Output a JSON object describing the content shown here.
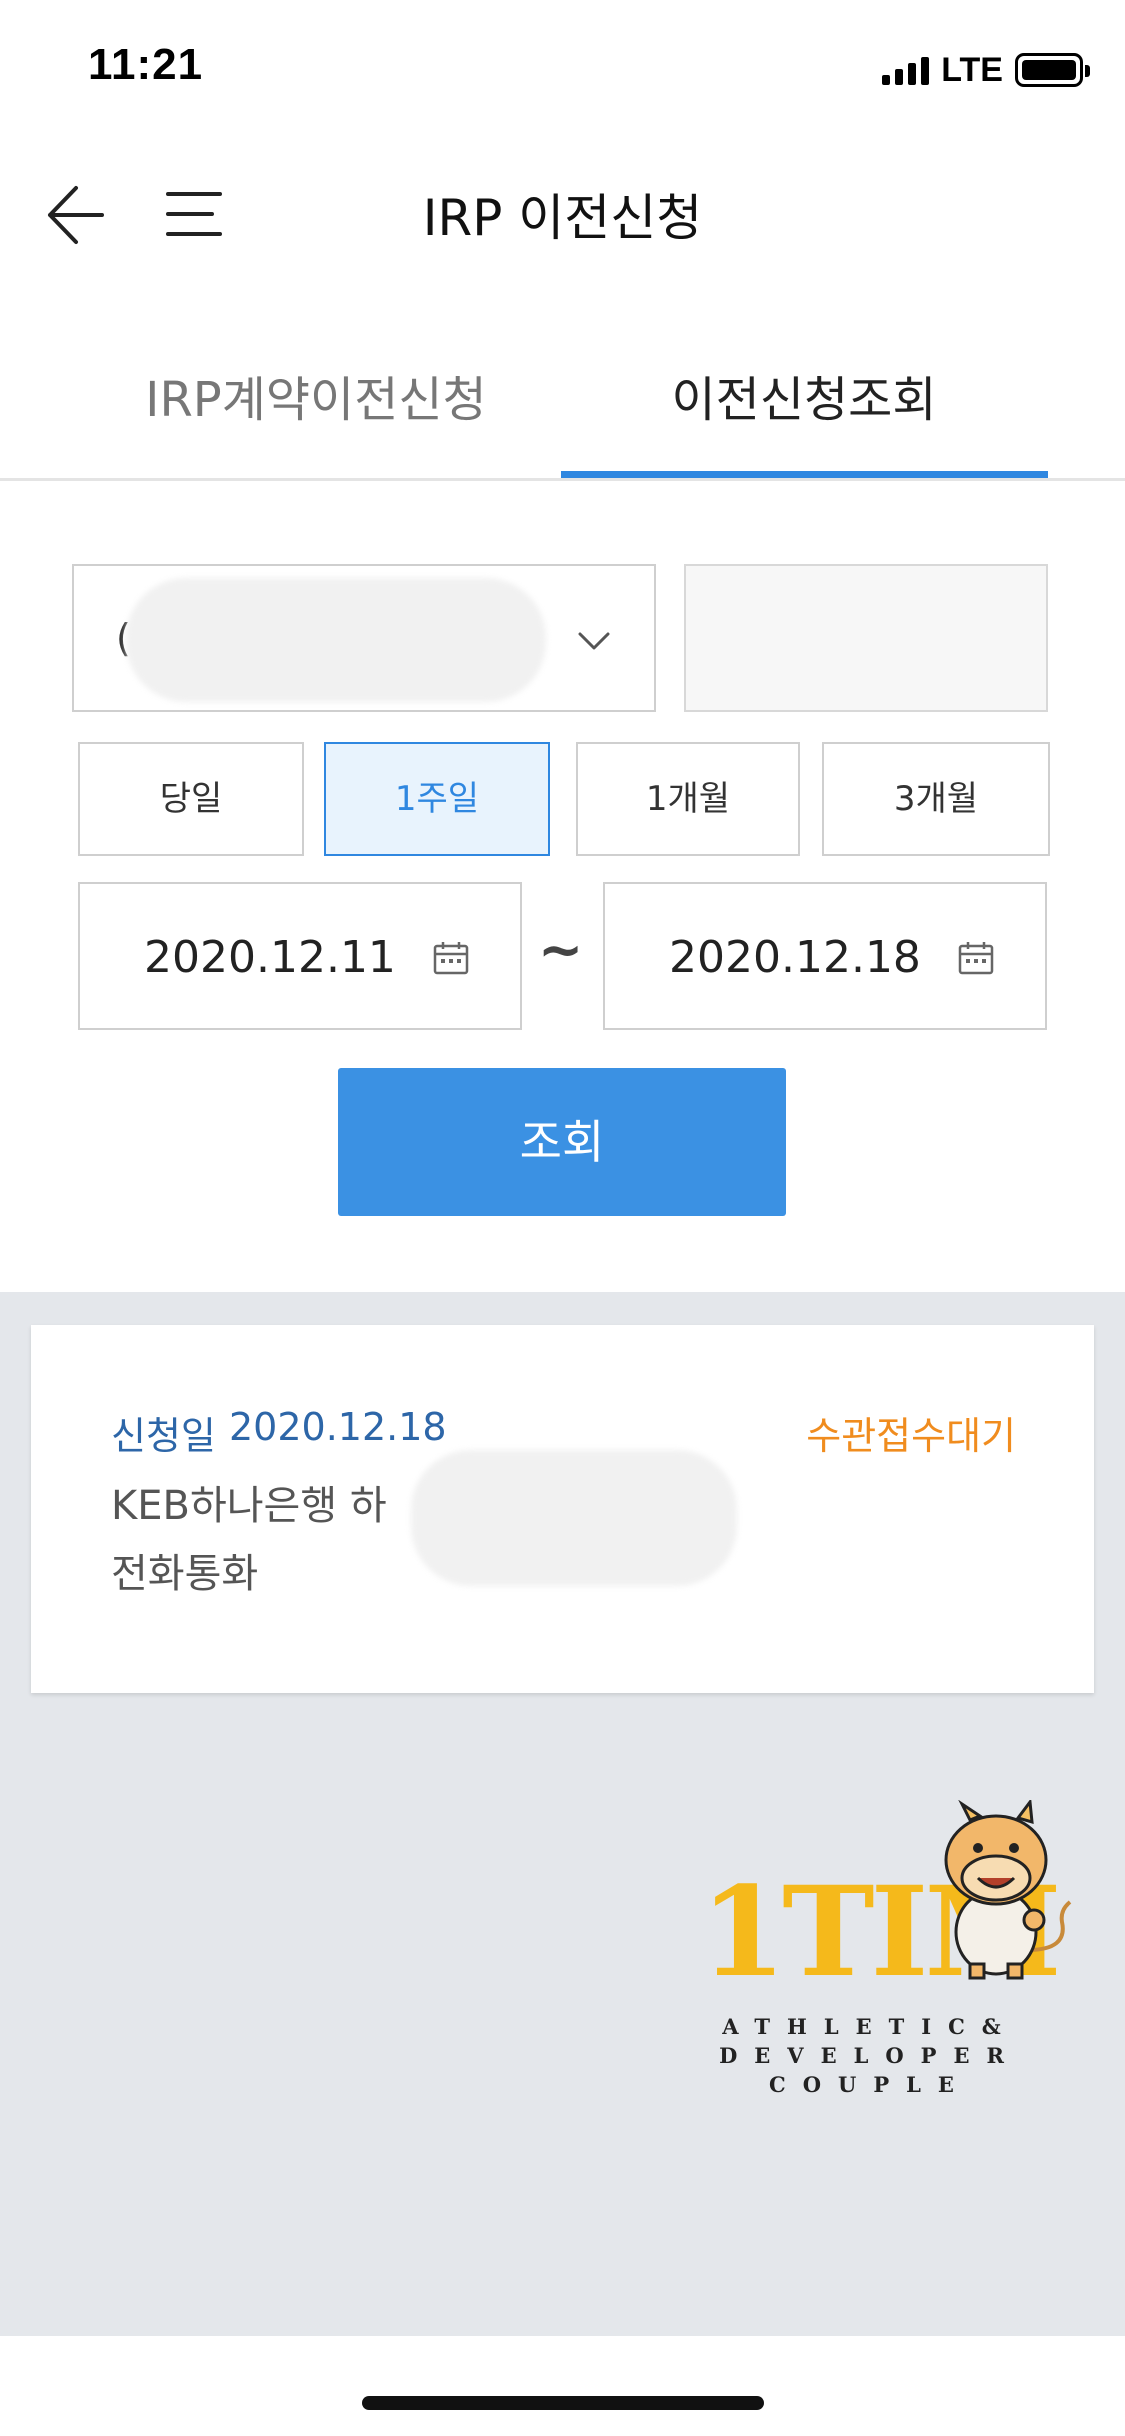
{
  "status_bar": {
    "time": "11:21",
    "network": "LTE"
  },
  "header": {
    "title": "IRP 이전신청"
  },
  "tabs": [
    {
      "label": "IRP계약이전신청",
      "active": false
    },
    {
      "label": "이전신청조회",
      "active": true
    }
  ],
  "filter": {
    "account_prefix": "(",
    "periods": [
      {
        "label": "당일",
        "active": false
      },
      {
        "label": "1주일",
        "active": true
      },
      {
        "label": "1개월",
        "active": false
      },
      {
        "label": "3개월",
        "active": false
      }
    ],
    "start_date": "2020.12.11",
    "range_separator": "~",
    "end_date": "2020.12.18",
    "search_label": "조회"
  },
  "result": {
    "date_label": "신청일",
    "date_value": "2020.12.18",
    "status": "수관접수대기",
    "line1": "KEB하나은행 하",
    "line2": "전화통화"
  },
  "logo": {
    "text": "1TIM",
    "tagline": [
      "ATHLETIC&",
      "DEVELOPER",
      "COUPLE"
    ]
  },
  "colors": {
    "accent": "#2f87e0",
    "button": "#3b91e3",
    "status_orange": "#f08c1e",
    "date_blue": "#2d66a8",
    "background_gray": "#e4e7eb",
    "logo_yellow": "#f5b91b"
  }
}
